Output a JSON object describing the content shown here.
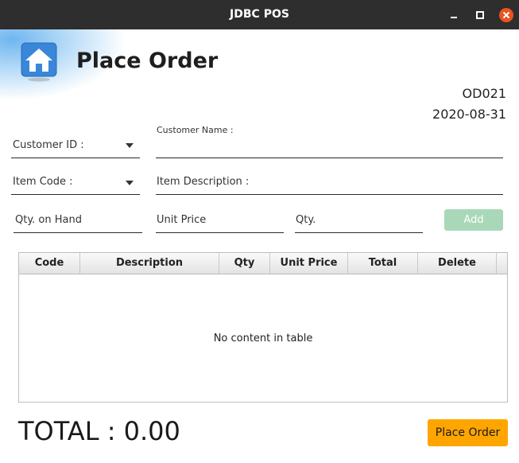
{
  "window": {
    "title": "JDBC POS"
  },
  "header": {
    "title": "Place Order",
    "order_id": "OD021",
    "date": "2020-08-31"
  },
  "form": {
    "customer_id_label": "Customer ID :",
    "customer_name_label": "Customer Name :",
    "customer_name_value": "",
    "item_code_label": "Item Code :",
    "item_description_label": "Item Description :",
    "qty_on_hand_label": "Qty. on Hand",
    "unit_price_label": "Unit Price",
    "qty_label": "Qty.",
    "add_label": "Add"
  },
  "table": {
    "columns": [
      "Code",
      "Description",
      "Qty",
      "Unit Price",
      "Total",
      "Delete"
    ],
    "rows": [],
    "empty_message": "No content in table"
  },
  "footer": {
    "total_text": "TOTAL : 0.00",
    "place_order_label": "Place Order"
  },
  "colors": {
    "add_button": "#a9d8b8",
    "place_order_button": "#ffa500",
    "close_button": "#e95420",
    "titlebar": "#2e2e2e"
  }
}
